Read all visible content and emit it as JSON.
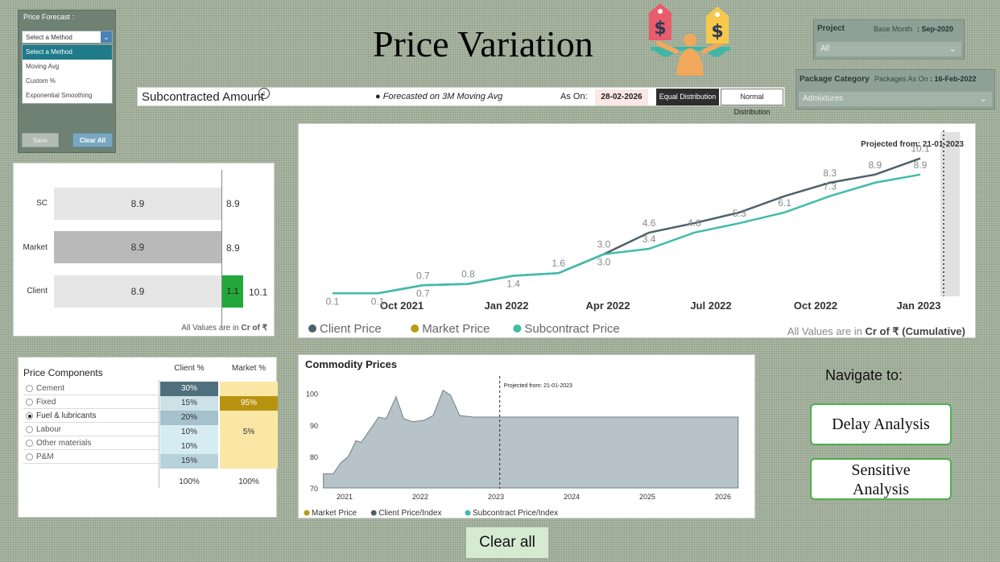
{
  "forecast_panel": {
    "title": "Price Forecast :",
    "selected": "Select a Method",
    "options": [
      "Select a Method",
      "Moving Avg",
      "Custom %",
      "Exponential Smoothing"
    ],
    "save_label": "Save",
    "clear_label": "Clear All"
  },
  "header": {
    "title": "Price Variation"
  },
  "project_filter": {
    "label": "Project",
    "base_month_label": "Base Month",
    "base_month_value": ": Sep-2020",
    "value": "All"
  },
  "package_filter": {
    "label": "Package Category",
    "as_on_label": "Packages As On",
    "as_on_value": ": 16-Feb-2022",
    "value": "Admixtures"
  },
  "subcontract_bar": {
    "title": "Subcontracted Amount",
    "info": "i",
    "note": "● Forecasted on 3M Moving Avg",
    "as_on_label": "As On:",
    "as_on_value": "28-02-2026",
    "equal_label": "Equal Distribution",
    "normal_label": "Normal Distribution"
  },
  "comparison_chart": {
    "rows": [
      {
        "label": "SC",
        "value": "8.9",
        "total": "8.9",
        "extra": ""
      },
      {
        "label": "Market",
        "value": "8.9",
        "total": "8.9",
        "extra": ""
      },
      {
        "label": "Client",
        "value": "8.9",
        "total": "10.1",
        "extra": "1.1"
      }
    ],
    "footer_prefix": "All Values are in ",
    "footer_unit": "Cr of ₹"
  },
  "chart_data": [
    {
      "type": "line",
      "projected_label": "Projected from: 21-01-2023",
      "x_ticks": [
        "Oct 2021",
        "Jan 2022",
        "Apr 2022",
        "Jul 2022",
        "Oct 2022",
        "Jan 2023"
      ],
      "series": [
        {
          "name": "Client Price",
          "color": "#4f6168",
          "points": [
            0.1,
            0.1,
            0.7,
            0.8,
            1.4,
            1.6,
            3.0,
            4.6,
            5.3,
            6.1,
            7.3,
            8.3,
            8.9,
            10.1
          ],
          "labels": [
            "0.1",
            "0.1",
            "0.7",
            "",
            "1.4",
            "",
            "3.0",
            "4.6",
            "",
            "",
            "",
            "8.3",
            "8.9",
            "10.1"
          ]
        },
        {
          "name": "Market Price",
          "color": "#b89a17",
          "points": [],
          "labels": []
        },
        {
          "name": "Subcontract Price",
          "color": "#3fbcab",
          "points": [
            0.1,
            0.1,
            0.7,
            0.8,
            1.4,
            1.6,
            3.0,
            3.4,
            4.6,
            5.3,
            6.1,
            7.3,
            8.3,
            8.9
          ],
          "labels": [
            "",
            "",
            "0.7",
            "0.8",
            "",
            "1.6",
            "3.0",
            "3.4",
            "4.6",
            "5.3",
            "6.1",
            "7.3",
            "",
            "8.9"
          ]
        }
      ],
      "footer_prefix": "All Values are in ",
      "footer_unit": "Cr of ₹ (Cumulative)"
    },
    {
      "type": "area",
      "title": "Commodity Prices",
      "projected_label": "Projected from: 21-01-2023",
      "y_ticks": [
        70,
        80,
        90,
        100
      ],
      "x_ticks": [
        "2021",
        "2022",
        "2023",
        "2024",
        "2025",
        "2026"
      ],
      "legend": [
        "Market Price",
        "Client Price/Index",
        "Subcontract Price/Index"
      ],
      "legend_colors": [
        "#b89a17",
        "#4f6168",
        "#3fbcab"
      ]
    }
  ],
  "price_components": {
    "title": "Price Components",
    "col_client": "Client %",
    "col_market": "Market %",
    "items": [
      "Cement",
      "Fixed",
      "Fuel & lubricants",
      "Labour",
      "Other materials",
      "P&M"
    ],
    "selected_index": 2,
    "client": [
      "30%",
      "15%",
      "20%",
      "10%",
      "10%",
      "15%"
    ],
    "market": [
      "",
      "95%",
      "",
      "5%",
      "",
      ""
    ],
    "client_total": "100%",
    "market_total": "100%"
  },
  "navigate": {
    "label": "Navigate to:",
    "delay_label": "Delay Analysis",
    "sensitive_line1": "Sensitive",
    "sensitive_line2": "Analysis"
  },
  "footer": {
    "clear_all": "Clear all"
  }
}
